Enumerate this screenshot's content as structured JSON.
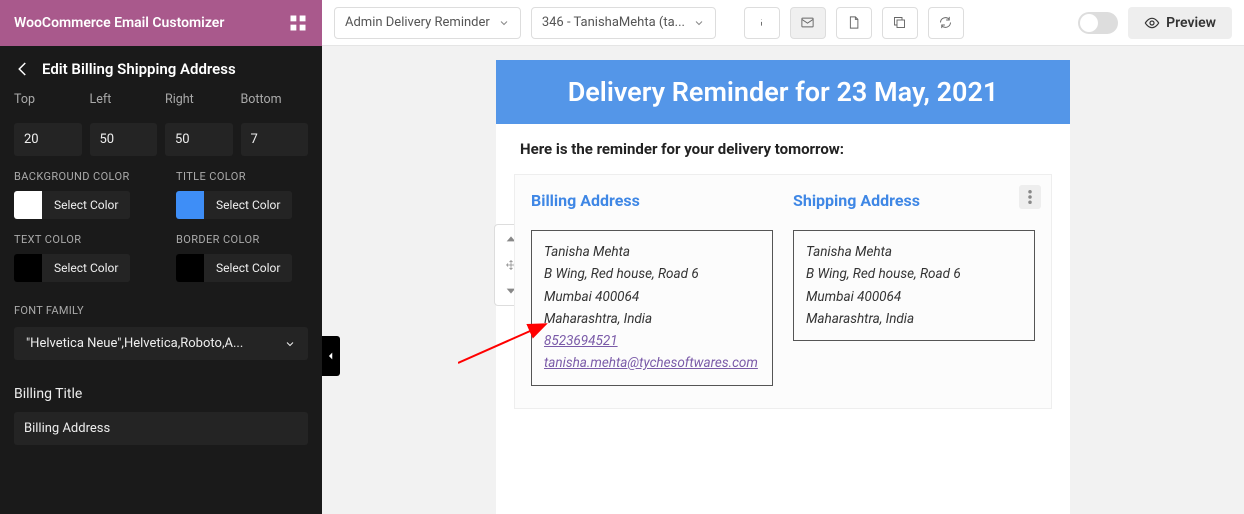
{
  "header": {
    "app_title": "WooCommerce Email Customizer"
  },
  "panel": {
    "title": "Edit Billing Shipping Address",
    "padding": {
      "top_label": "Top",
      "left_label": "Left",
      "right_label": "Right",
      "bottom_label": "Bottom",
      "top": "20",
      "left": "50",
      "right": "50",
      "bottom": "7"
    },
    "bg_label": "BACKGROUND COLOR",
    "title_color_label": "TITLE COLOR",
    "text_color_label": "TEXT COLOR",
    "border_color_label": "BORDER COLOR",
    "select_color": "Select Color",
    "font_label": "FONT FAMILY",
    "font_value": "\"Helvetica Neue\",Helvetica,Roboto,A...",
    "billing_title_label": "Billing Title",
    "billing_title_value": "Billing Address"
  },
  "topbar": {
    "template": "Admin Delivery Reminder",
    "order": "346 - TanishaMehta (ta...",
    "preview": "Preview"
  },
  "email": {
    "header": "Delivery Reminder for 23 May, 2021",
    "sub": "Here is the reminder for your delivery tomorrow:",
    "billing_title": "Billing Address",
    "shipping_title": "Shipping Address",
    "billing": {
      "name": "Tanisha Mehta",
      "line1": "B Wing, Red house, Road 6",
      "line2": "Mumbai 400064",
      "line3": "Maharashtra, India",
      "phone": "8523694521",
      "email": "tanisha.mehta@tychesoftwares.com"
    },
    "shipping": {
      "name": "Tanisha Mehta",
      "line1": "B Wing, Red house, Road 6",
      "line2": "Mumbai 400064",
      "line3": "Maharashtra, India"
    }
  }
}
